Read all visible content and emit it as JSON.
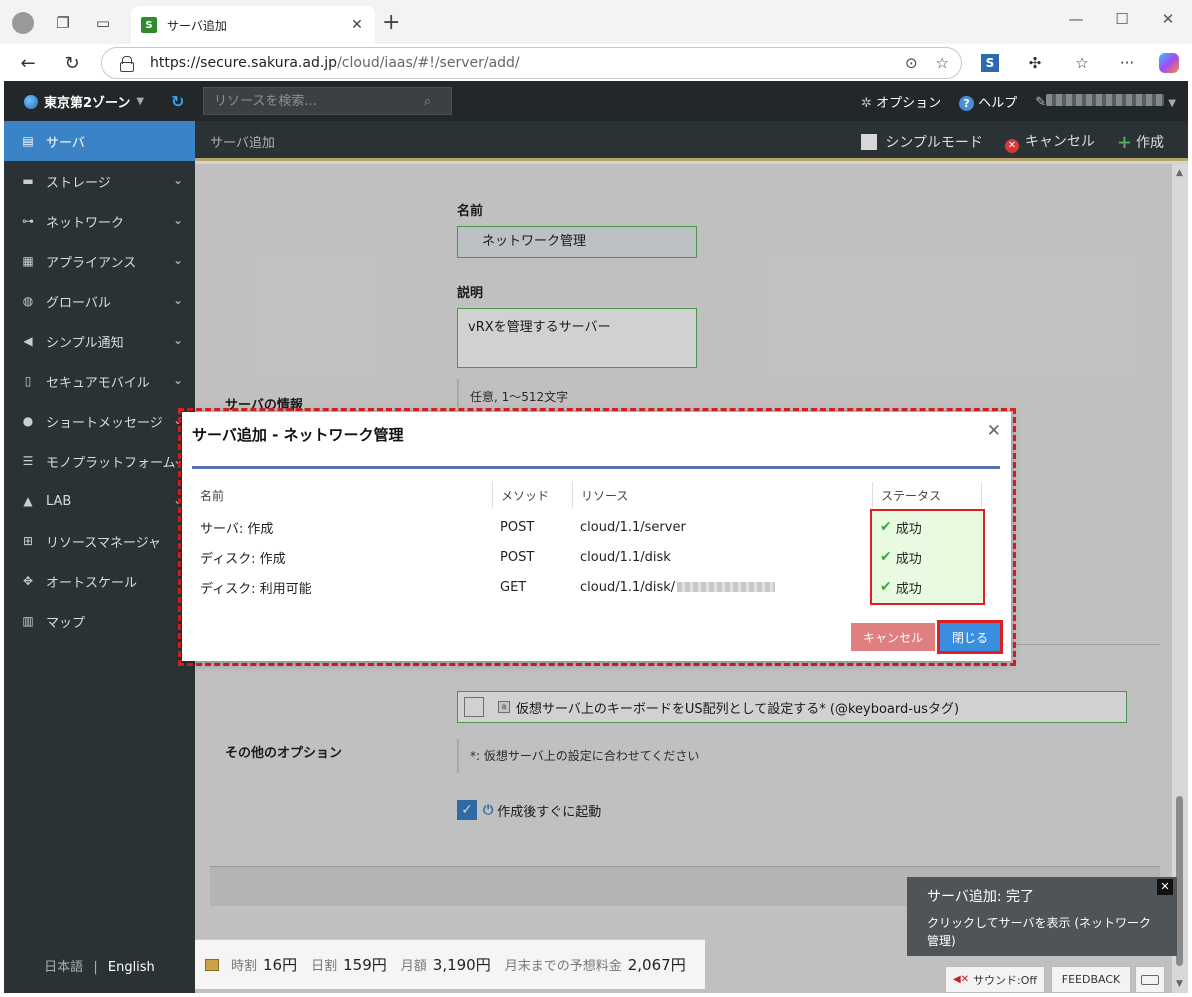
{
  "browser": {
    "tab_title": "サーバ追加",
    "url_host": "https://secure.sakura.ad.jp",
    "url_path": "/cloud/iaas/#!/server/add/"
  },
  "topbar": {
    "zone": "東京第2ゾーン",
    "search_placeholder": "リソースを検索...",
    "option_label": "オプション",
    "help_label": "ヘルプ"
  },
  "sidebar": {
    "items": [
      {
        "label": "サーバ",
        "icon": "server-icon"
      },
      {
        "label": "ストレージ",
        "icon": "storage-icon"
      },
      {
        "label": "ネットワーク",
        "icon": "network-icon"
      },
      {
        "label": "アプライアンス",
        "icon": "appliance-icon"
      },
      {
        "label": "グローバル",
        "icon": "globe-icon"
      },
      {
        "label": "シンプル通知",
        "icon": "megaphone-icon"
      },
      {
        "label": "セキュアモバイル",
        "icon": "mobile-icon"
      },
      {
        "label": "ショートメッセージ",
        "icon": "chat-icon"
      },
      {
        "label": "モノプラットフォーム",
        "icon": "list-icon"
      },
      {
        "label": "LAB",
        "icon": "flask-icon"
      },
      {
        "label": "リソースマネージャ",
        "icon": "tree-icon"
      },
      {
        "label": "オートスケール",
        "icon": "move-icon"
      },
      {
        "label": "マップ",
        "icon": "map-icon"
      }
    ],
    "lang_ja": "日本語",
    "lang_sep": "|",
    "lang_en": "English"
  },
  "subheader": {
    "title": "サーバ追加",
    "simple_mode": "シンプルモード",
    "cancel": "キャンセル",
    "create": "作成"
  },
  "form": {
    "name_label": "名前",
    "name_value": "ネットワーク管理",
    "desc_label": "説明",
    "desc_value": "vRXを管理するサーバー",
    "desc_hint": "任意, 1〜512文字",
    "info_label": "サーバの情報",
    "keyboard_option": "仮想サーバ上のキーボードをUS配列として設定する* (@keyboard-usタグ)",
    "other_label": "その他のオプション",
    "other_note": "*: 仮想サーバ上の設定に合わせてください",
    "boot_label": "作成後すぐに起動"
  },
  "price": {
    "hourly_label": "時割",
    "hourly_value": "16円",
    "daily_label": "日割",
    "daily_value": "159円",
    "monthly_label": "月額",
    "monthly_value": "3,190円",
    "estimate_label": "月末までの予想料金",
    "estimate_value": "2,067円"
  },
  "modal": {
    "title": "サーバ追加 - ネットワーク管理",
    "headers": [
      "名前",
      "メソッド",
      "リソース",
      "ステータス"
    ],
    "rows": [
      {
        "name": "サーバ: 作成",
        "method": "POST",
        "resource": "cloud/1.1/server",
        "status": "成功"
      },
      {
        "name": "ディスク: 作成",
        "method": "POST",
        "resource": "cloud/1.1/disk",
        "status": "成功"
      },
      {
        "name": "ディスク: 利用可能",
        "method": "GET",
        "resource": "cloud/1.1/disk/",
        "status": "成功"
      }
    ],
    "cancel_label": "キャンセル",
    "close_label": "閉じる"
  },
  "toast": {
    "title": "サーバ追加: 完了",
    "body": "クリックしてサーバを表示 (ネットワーク管理)"
  },
  "footer": {
    "sound_label": "サウンド:Off",
    "feedback_label": "FEEDBACK"
  },
  "colors": {
    "accent": "#3a83c6",
    "highlight": "#e02020",
    "success": "#3fa63f"
  }
}
